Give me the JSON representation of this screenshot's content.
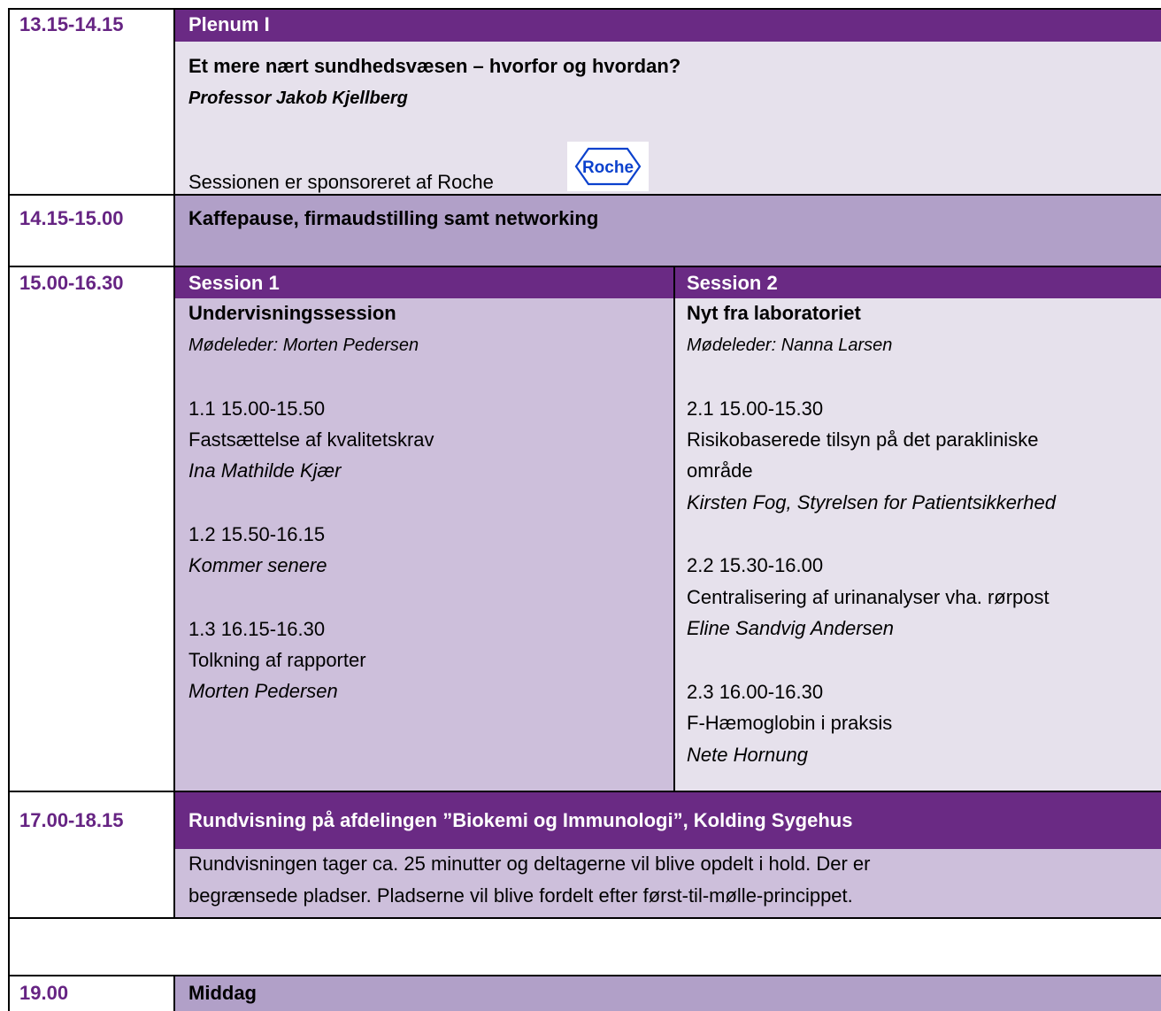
{
  "rows": {
    "plenum": {
      "time": "13.15-14.15",
      "header": "Plenum I",
      "title": "Et mere nært sundhedsvæsen – hvorfor og hvordan?",
      "speaker": "Professor Jakob Kjellberg",
      "sponsor_text": "Sessionen er sponsoreret af Roche",
      "sponsor_logo": "Roche"
    },
    "break": {
      "time": "14.15-15.00",
      "title": "Kaffepause, firmaudstilling samt networking"
    },
    "sessions": {
      "time": "15.00-16.30",
      "session1": {
        "header": "Session 1",
        "title": "Undervisningssession",
        "moderator": "Mødeleder: Morten Pedersen",
        "talks": [
          {
            "slot": "1.1  15.00-15.50",
            "title": "Fastsættelse af kvalitetskrav",
            "speaker": "Ina Mathilde Kjær"
          },
          {
            "slot": "1.2  15.50-16.15",
            "speaker": "Kommer senere"
          },
          {
            "slot": "1.3  16.15-16.30",
            "title": "Tolkning af rapporter",
            "speaker": "Morten Pedersen"
          }
        ]
      },
      "session2": {
        "header": "Session 2",
        "title": "Nyt fra laboratoriet",
        "moderator": "Mødeleder: Nanna Larsen",
        "talks": [
          {
            "slot": "2.1 15.00-15.30",
            "title_line1": "Risikobaserede tilsyn på det parakliniske",
            "title_line2": "område",
            "speaker": "Kirsten Fog, Styrelsen for Patientsikkerhed"
          },
          {
            "slot": "2.2 15.30-16.00",
            "title": "Centralisering af urinanalyser vha. rørpost",
            "speaker": "Eline Sandvig Andersen"
          },
          {
            "slot": "2.3 16.00-16.30",
            "title": "F-Hæmoglobin i praksis",
            "speaker": "Nete Hornung"
          }
        ]
      }
    },
    "tour": {
      "time": "17.00-18.15",
      "header": "Rundvisning på afdelingen ”Biokemi og Immunologi”, Kolding Sygehus",
      "text_line1": "Rundvisningen tager ca. 25 minutter og deltagerne vil blive opdelt i hold. Der er",
      "text_line2": "begrænsede pladser. Pladserne vil blive fordelt efter først-til-mølle-princippet."
    },
    "dinner": {
      "time": "19.00",
      "title": "Middag"
    }
  },
  "colors": {
    "header_purple": "#6a2a84",
    "time_purple": "#662483",
    "light_lavender": "#e6e1ec",
    "mid_lavender": "#b1a0c8",
    "session_lavender": "#cdbfdb"
  }
}
